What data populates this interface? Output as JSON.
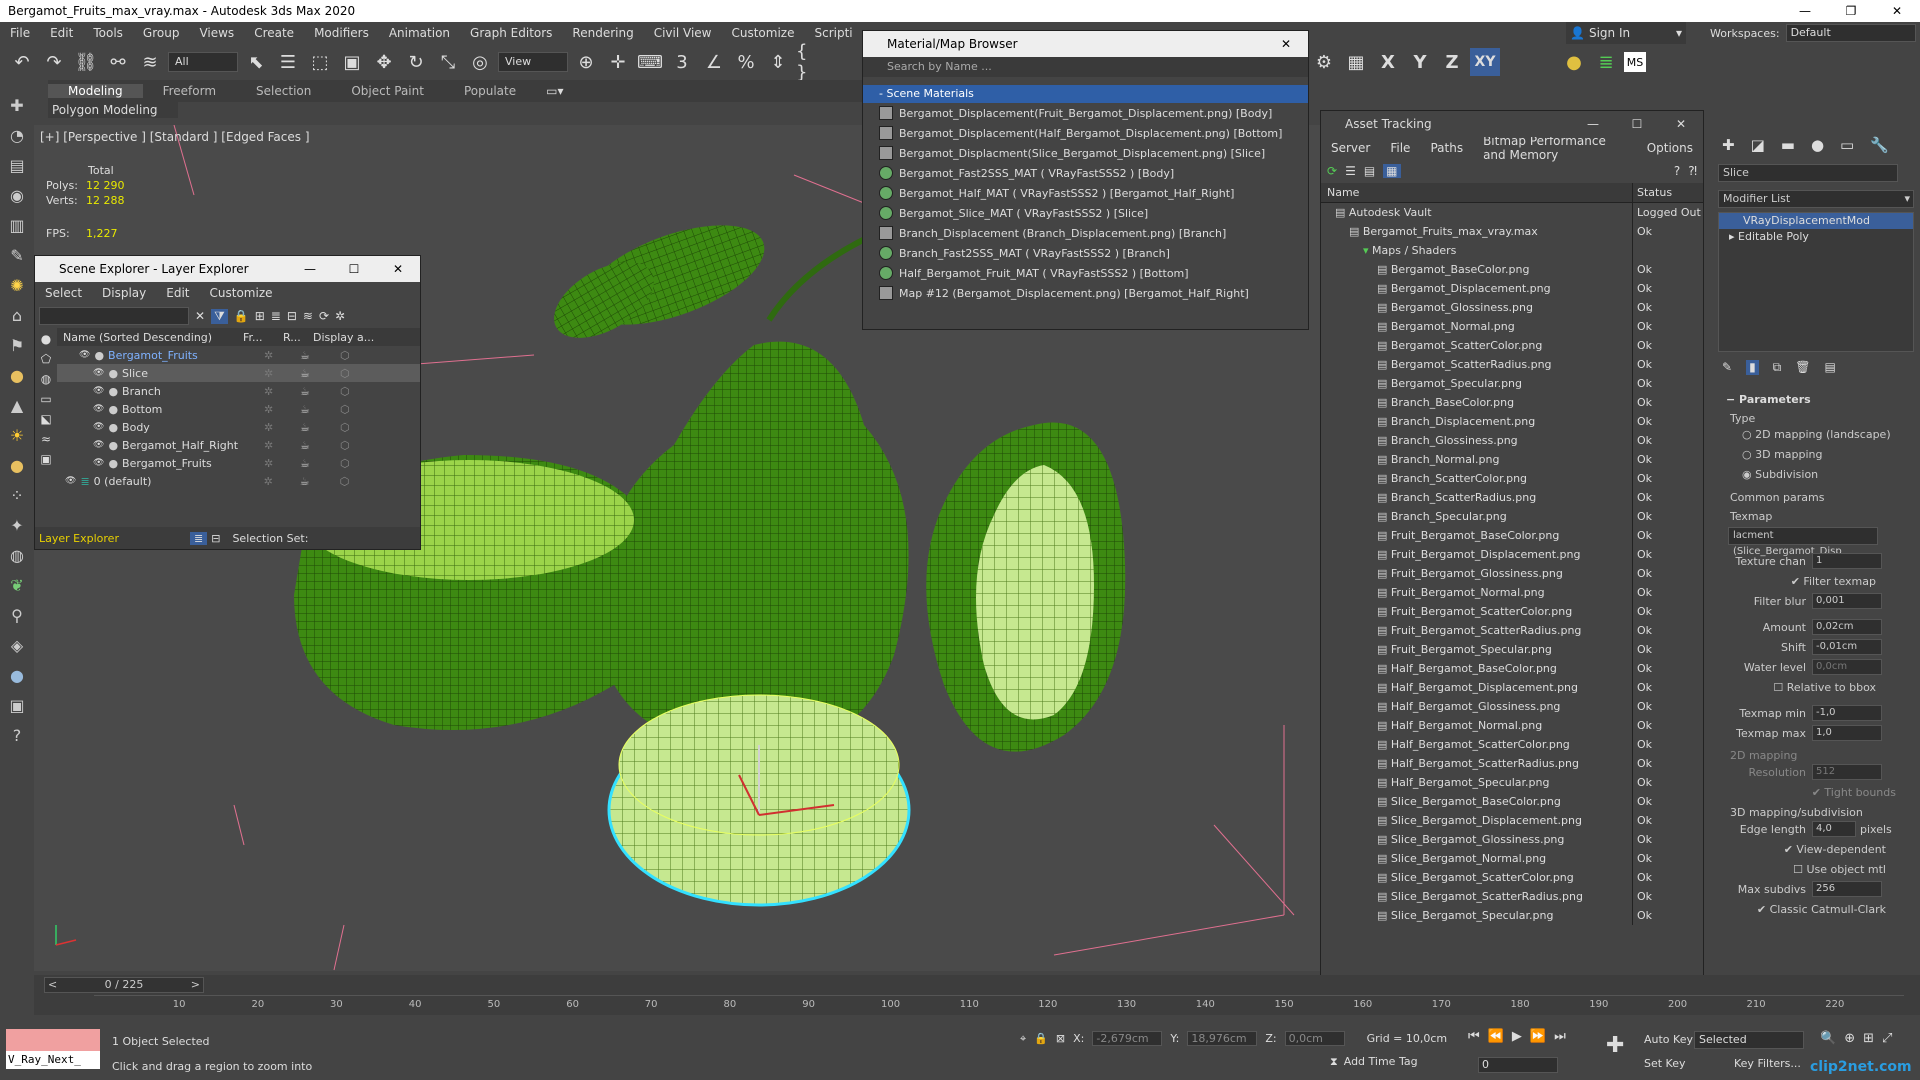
{
  "window": {
    "title": "Bergamot_Fruits_max_vray.max - Autodesk 3ds Max 2020"
  },
  "menu": [
    "File",
    "Edit",
    "Tools",
    "Group",
    "Views",
    "Create",
    "Modifiers",
    "Animation",
    "Graph Editors",
    "Rendering",
    "Civil View",
    "Customize",
    "Scripti"
  ],
  "toolbar": {
    "selection_filter": "All",
    "ref_coord": "View",
    "signin": "Sign In",
    "workspaces_label": "Workspaces:",
    "workspace": "Default",
    "axis_x": "X",
    "axis_y": "Y",
    "axis_z": "Z",
    "axis_xy": "XY"
  },
  "ribbon": {
    "tabs": [
      "Modeling",
      "Freeform",
      "Selection",
      "Object Paint",
      "Populate"
    ],
    "sub": "Polygon Modeling"
  },
  "viewport": {
    "label": "[+] [Perspective ] [Standard ] [Edged Faces ]",
    "total": "Total",
    "polys_label": "Polys:",
    "polys": "12 290",
    "verts_label": "Verts:",
    "verts": "12 288",
    "fps_label": "FPS:",
    "fps": "1,227"
  },
  "material_browser": {
    "title": "Material/Map Browser",
    "search": "Search by Name ...",
    "section": "- Scene Materials",
    "items": [
      {
        "label": "Bergamot_Displacement(Fruit_Bergamot_Displacement.png) [Body]",
        "kind": "map"
      },
      {
        "label": "Bergamot_Displacement(Half_Bergamot_Displacement.png) [Bottom]",
        "kind": "map"
      },
      {
        "label": "Bergamot_Displacment(Slice_Bergamot_Displacement.png) [Slice]",
        "kind": "map"
      },
      {
        "label": "Bergamot_Fast2SSS_MAT ( VRayFastSSS2 ) [Body]",
        "kind": "mtl"
      },
      {
        "label": "Bergamot_Half_MAT ( VRayFastSSS2 ) [Bergamot_Half_Right]",
        "kind": "mtl"
      },
      {
        "label": "Bergamot_Slice_MAT ( VRayFastSSS2 ) [Slice]",
        "kind": "mtl"
      },
      {
        "label": "Branch_Displacement (Branch_Displacement.png) [Branch]",
        "kind": "map"
      },
      {
        "label": "Branch_Fast2SSS_MAT ( VRayFastSSS2 ) [Branch]",
        "kind": "mtl"
      },
      {
        "label": "Half_Bergamot_Fruit_MAT ( VRayFastSSS2 ) [Bottom]",
        "kind": "mtl"
      },
      {
        "label": "Map #12 (Bergamot_Displacement.png) [Bergamot_Half_Right]",
        "kind": "map"
      }
    ]
  },
  "layer_explorer": {
    "title": "Scene Explorer - Layer Explorer",
    "menu": [
      "Select",
      "Display",
      "Edit",
      "Customize"
    ],
    "columns": [
      "Name (Sorted Descending)",
      "Fr...",
      "R...",
      "Display a..."
    ],
    "rows": [
      "Bergamot_Fruits",
      "Slice",
      "Branch",
      "Bottom",
      "Body",
      "Bergamot_Half_Right",
      "Bergamot_Fruits",
      "0 (default)"
    ],
    "footer_mode": "Layer Explorer",
    "selection_set": "Selection Set:"
  },
  "asset_tracking": {
    "title": "Asset Tracking",
    "menu": [
      "Server",
      "File",
      "Paths",
      "Bitmap Performance and Memory",
      "Options"
    ],
    "columns": [
      "Name",
      "Status"
    ],
    "rows": [
      {
        "name": "Autodesk Vault",
        "status": "Logged Out",
        "indent": 1
      },
      {
        "name": "Bergamot_Fruits_max_vray.max",
        "status": "Ok",
        "indent": 2
      },
      {
        "name": "Maps / Shaders",
        "status": "",
        "indent": 3
      },
      {
        "name": "Bergamot_BaseColor.png",
        "status": "Ok",
        "indent": 4
      },
      {
        "name": "Bergamot_Displacement.png",
        "status": "Ok",
        "indent": 4
      },
      {
        "name": "Bergamot_Glossiness.png",
        "status": "Ok",
        "indent": 4
      },
      {
        "name": "Bergamot_Normal.png",
        "status": "Ok",
        "indent": 4
      },
      {
        "name": "Bergamot_ScatterColor.png",
        "status": "Ok",
        "indent": 4
      },
      {
        "name": "Bergamot_ScatterRadius.png",
        "status": "Ok",
        "indent": 4
      },
      {
        "name": "Bergamot_Specular.png",
        "status": "Ok",
        "indent": 4
      },
      {
        "name": "Branch_BaseColor.png",
        "status": "Ok",
        "indent": 4
      },
      {
        "name": "Branch_Displacement.png",
        "status": "Ok",
        "indent": 4
      },
      {
        "name": "Branch_Glossiness.png",
        "status": "Ok",
        "indent": 4
      },
      {
        "name": "Branch_Normal.png",
        "status": "Ok",
        "indent": 4
      },
      {
        "name": "Branch_ScatterColor.png",
        "status": "Ok",
        "indent": 4
      },
      {
        "name": "Branch_ScatterRadius.png",
        "status": "Ok",
        "indent": 4
      },
      {
        "name": "Branch_Specular.png",
        "status": "Ok",
        "indent": 4
      },
      {
        "name": "Fruit_Bergamot_BaseColor.png",
        "status": "Ok",
        "indent": 4
      },
      {
        "name": "Fruit_Bergamot_Displacement.png",
        "status": "Ok",
        "indent": 4
      },
      {
        "name": "Fruit_Bergamot_Glossiness.png",
        "status": "Ok",
        "indent": 4
      },
      {
        "name": "Fruit_Bergamot_Normal.png",
        "status": "Ok",
        "indent": 4
      },
      {
        "name": "Fruit_Bergamot_ScatterColor.png",
        "status": "Ok",
        "indent": 4
      },
      {
        "name": "Fruit_Bergamot_ScatterRadius.png",
        "status": "Ok",
        "indent": 4
      },
      {
        "name": "Fruit_Bergamot_Specular.png",
        "status": "Ok",
        "indent": 4
      },
      {
        "name": "Half_Bergamot_BaseColor.png",
        "status": "Ok",
        "indent": 4
      },
      {
        "name": "Half_Bergamot_Displacement.png",
        "status": "Ok",
        "indent": 4
      },
      {
        "name": "Half_Bergamot_Glossiness.png",
        "status": "Ok",
        "indent": 4
      },
      {
        "name": "Half_Bergamot_Normal.png",
        "status": "Ok",
        "indent": 4
      },
      {
        "name": "Half_Bergamot_ScatterColor.png",
        "status": "Ok",
        "indent": 4
      },
      {
        "name": "Half_Bergamot_ScatterRadius.png",
        "status": "Ok",
        "indent": 4
      },
      {
        "name": "Half_Bergamot_Specular.png",
        "status": "Ok",
        "indent": 4
      },
      {
        "name": "Slice_Bergamot_BaseColor.png",
        "status": "Ok",
        "indent": 4
      },
      {
        "name": "Slice_Bergamot_Displacement.png",
        "status": "Ok",
        "indent": 4
      },
      {
        "name": "Slice_Bergamot_Glossiness.png",
        "status": "Ok",
        "indent": 4
      },
      {
        "name": "Slice_Bergamot_Normal.png",
        "status": "Ok",
        "indent": 4
      },
      {
        "name": "Slice_Bergamot_ScatterColor.png",
        "status": "Ok",
        "indent": 4
      },
      {
        "name": "Slice_Bergamot_ScatterRadius.png",
        "status": "Ok",
        "indent": 4
      },
      {
        "name": "Slice_Bergamot_Specular.png",
        "status": "Ok",
        "indent": 4
      }
    ]
  },
  "command_panel": {
    "name_field": "Slice",
    "modifier_list": "Modifier List",
    "stack": [
      "VRayDisplacementMod",
      "Editable Poly"
    ],
    "parameters": "Parameters",
    "type_label": "Type",
    "type_options": [
      "2D mapping (landscape)",
      "3D mapping",
      "Subdivision"
    ],
    "common_params": "Common params",
    "texmap_label": "Texmap",
    "texmap_value": "lacment (Slice_Bergamot_Disp",
    "texture_chan": "Texture chan",
    "texture_chan_val": "1",
    "filter_texmap": "Filter texmap",
    "filter_blur": "Filter blur",
    "filter_blur_val": "0,001",
    "amount": "Amount",
    "amount_val": "0,02cm",
    "shift": "Shift",
    "shift_val": "-0,01cm",
    "water_level": "Water level",
    "water_level_val": "0,0cm",
    "relative_bbox": "Relative to bbox",
    "texmap_min": "Texmap min",
    "texmap_min_val": "-1,0",
    "texmap_max": "Texmap max",
    "texmap_max_val": "1,0",
    "mapping2d": "2D mapping",
    "resolution": "Resolution",
    "resolution_val": "512",
    "tight_bounds": "Tight bounds",
    "mapping3d": "3D mapping/subdivision",
    "edge_length": "Edge length",
    "edge_length_val": "4,0",
    "pixels": "pixels",
    "view_dependent": "View-dependent",
    "use_object_mtl": "Use object mtl",
    "max_subdivs": "Max subdivs",
    "max_subdivs_val": "256",
    "classic_cc": "Classic Catmull-Clark"
  },
  "timeline": {
    "frame": "0 / 225",
    "ticks": [
      "10",
      "20",
      "30",
      "40",
      "50",
      "60",
      "70",
      "80",
      "90",
      "100",
      "110",
      "120",
      "130",
      "140",
      "150",
      "160",
      "170",
      "180",
      "190",
      "200",
      "210",
      "220"
    ]
  },
  "status": {
    "script": "V_Ray_Next_",
    "selected": "1 Object Selected",
    "hint": "Click and drag a region to zoom into",
    "x_label": "X:",
    "x_val": "-2,679cm",
    "y_label": "Y:",
    "y_val": "18,976cm",
    "z_label": "Z:",
    "z_val": "0,0cm",
    "grid": "Grid = 10,0cm",
    "add_time_tag": "Add Time Tag",
    "auto_key": "Auto Key",
    "selected_drop": "Selected",
    "set_key": "Set Key",
    "key_filters": "Key Filters...",
    "frame_field": "0",
    "watermark": "clip2net.com"
  }
}
